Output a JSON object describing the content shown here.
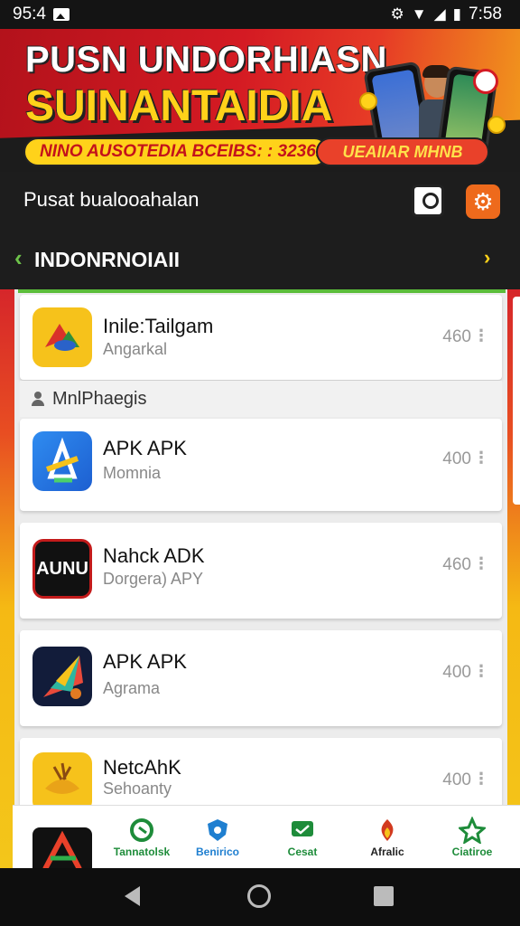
{
  "status_bar": {
    "time_left": "95:4",
    "time_right": "7:58"
  },
  "banner": {
    "title_line1": "PUSN UNDORHIASN",
    "title_line2": "SUINANTAIDIA",
    "strip_left": "NINO AUSOTEDIA BCEIBS: : 32361",
    "strip_right": "UEAIIAR MHNB"
  },
  "toolbar": {
    "title": "Pusat bualooahalan",
    "region": "INDONRNOIAII"
  },
  "section": {
    "label": "MnlPhaegis"
  },
  "apps": [
    {
      "name": "Inile:Tailgam",
      "sub": "Angarkal",
      "count": "460"
    },
    {
      "name": "APK APK",
      "sub": "Momnia",
      "count": "400"
    },
    {
      "name": "Nahck ADK",
      "sub": "Dorgera) APY",
      "count": "460"
    },
    {
      "name": "APK APK",
      "sub": "Agrama",
      "count": "400"
    },
    {
      "name": "NetcAhK",
      "sub": "Sehoanty",
      "count": "400"
    }
  ],
  "app3_icon_text": "AUNU",
  "tabs": [
    {
      "label": "Tannatolsk",
      "icon": "home-icon",
      "color": "#1e8c3a"
    },
    {
      "label": "Benirico",
      "icon": "shield-icon",
      "color": "#1f7fd0"
    },
    {
      "label": "Cesat",
      "icon": "chat-icon",
      "color": "#1e8c3a"
    },
    {
      "label": "Afralic",
      "icon": "fire-icon",
      "color": "#d23a1f"
    },
    {
      "label": "Ciatiroe",
      "icon": "star-icon",
      "color": "#1e8c3a"
    }
  ]
}
